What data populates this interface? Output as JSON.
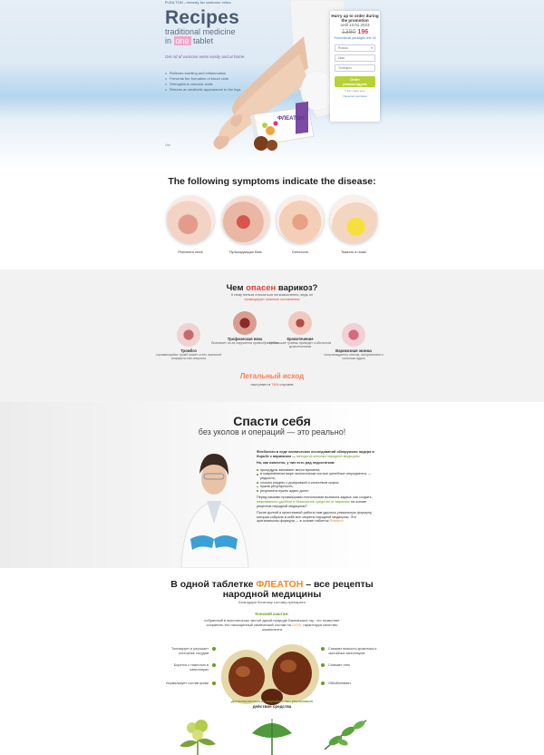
{
  "hero": {
    "site_label": "FLEA TON - remedy for varicose veins",
    "title": "Recipes",
    "subtitle_1": "traditional medicine",
    "subtitle_pre": "in ",
    "subtitle_hl": "one",
    "subtitle_post": " tablet",
    "tagline": "Get rid of varicose veins easily and at home",
    "bullets": [
      "Relieves swelling and inflammation",
      "Prevents the formation of blood clots",
      "Strengthens vascular walls",
      "Returns an aesthetic appearance to the legs"
    ],
    "note": "Use "
  },
  "order": {
    "hurry": "Hurry up to order during the promotion",
    "until": "until 13.01.2023",
    "old_price": "1390",
    "new_price": "196",
    "promo": "Promotional packages left: 16",
    "country": "Russia",
    "name_placeholder": "Имя",
    "phone_placeholder": "Телефон",
    "button_line1": "Order",
    "button_line2": "рекомендуем",
    "footer": "У вас сразу есть",
    "safe": "Гарантия доставки"
  },
  "product": {
    "name": "ФЛЕАТОН"
  },
  "symptoms": {
    "title": "The following symptoms indicate the disease:",
    "items": [
      {
        "label": "Prominent veins"
      },
      {
        "label": "Пульсирующая боль"
      },
      {
        "label": "Отечность"
      },
      {
        "label": "Тяжесть в ногах"
      }
    ]
  },
  "danger": {
    "title_pre": "Чем ",
    "title_red": "опасен",
    "title_post": " варикоз?",
    "sub_1": "К нему нельзя относиться легкомысленно, ведь он",
    "sub_2": "провоцирует опасные осложнения",
    "items": [
      {
        "title": "Тромбоз",
        "text": "отрывающийся тромб может стать причиной инфаркта или инсульта"
      },
      {
        "title": "Трофическая язва",
        "text": "Возникает из-за нарушения кровообращения"
      },
      {
        "title": "Кровотечение",
        "text": "Небольшие травмы приводят к обильным кровотечениям"
      },
      {
        "title": "Варикозная экзема",
        "text": "сопровождается отеком, шелушением и сильным зудом"
      }
    ],
    "lethal": "Летальный исход",
    "lethal_pre": "наступает в ",
    "lethal_pct": "76%",
    "lethal_post": " случаев"
  },
  "save": {
    "title": "Спасти себя",
    "subtitle": "без уколов и операций — это реально!",
    "p1_pre": "Флебологи в ходе клинических исследований обнаружили лидера в борьбе с варикозом — ",
    "p1_hl": "метода из копилки народной медицины",
    "p2": "Но, как известно, у них есть ряд недостатков:",
    "list": [
      "процедуры занимают много времени;",
      "в современном мире экологически чистые целебные ингредиенты — редкость;",
      "сложно угадать с дозировкой и качеством сырья;",
      "нужна регулярность;",
      "результата нужно ждать долго"
    ],
    "p3_pre": "Перед нашими провизорами-технологами возникла задача: как создать ",
    "p3_hl": "максимально удобное и безопасное средство от варикоза",
    "p3_post": " на основе рецептов народной медицины?",
    "p4_pre": "После долгой и кропотливой работы нам удалось уникальную формулу, которая собрала в себе все секреты народной медицины. Это оригинальная формула — в основе таблеток ",
    "p4_hl": "Флеатон"
  },
  "recipes": {
    "title_pre": "В одной таблетке ",
    "title_brand": "ФЛЕАТОН",
    "title_post": " – все рецепты",
    "title_2": "народной медицины",
    "sub": "Благодаря богатому составу препарата",
    "ingredient": "Конский каштан:",
    "p_pre": "собранный в экологически чистой дикой природе Балканских гор, что позволяет сохранить его насыщенный химический состав на ",
    "p_pct": "100%",
    "p_post": ", гарантируя качество компонента",
    "left": [
      "Тонизирует и улучшает состояние сосудов",
      "Борется с тяжестью в капиллярах",
      "Нормализует состав крови"
    ],
    "right": [
      "Снижает вязкость кровотока и застойных капилляров",
      "Снимает отек",
      "Обезболивает"
    ],
    "bottom_1": "Дополнительные ингредиенты усиливают",
    "bottom_2": "действие средства"
  },
  "colors": {
    "accent_pink": "#e2336b",
    "accent_green": "#6a9b1f",
    "accent_orange": "#f08a24",
    "danger_red": "#e53c3c"
  }
}
